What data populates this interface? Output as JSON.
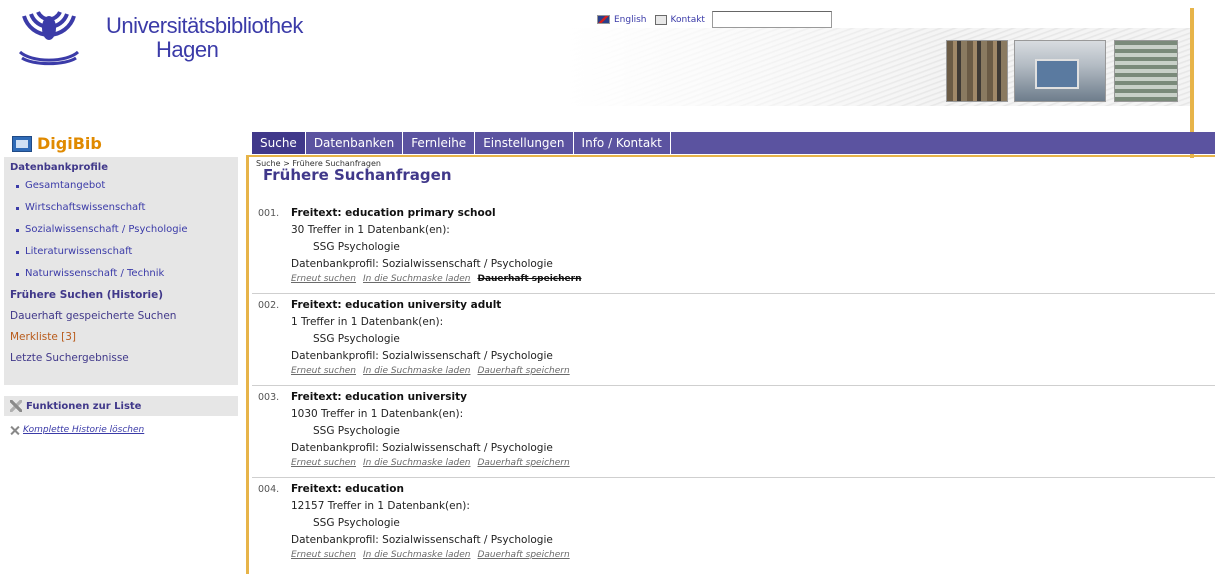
{
  "header": {
    "logo_line1": "Universitätsbibliothek",
    "logo_line2": "Hagen",
    "english_label": "English",
    "contact_label": "Kontakt",
    "search_value": ""
  },
  "brand": {
    "digibib_label": "DigiBib"
  },
  "nav": {
    "tabs": [
      {
        "label": "Suche",
        "active": true
      },
      {
        "label": "Datenbanken"
      },
      {
        "label": "Fernleihe"
      },
      {
        "label": "Einstellungen"
      },
      {
        "label": "Info / Kontakt"
      }
    ],
    "breadcrumb": "Suche > Frühere Suchanfragen"
  },
  "sidebar": {
    "heading": "Datenbankprofile",
    "profiles": [
      "Gesamtangebot",
      "Wirtschaftswissenschaft",
      "Sozialwissenschaft / Psychologie",
      "Literaturwissenschaft",
      "Naturwissenschaft / Technik"
    ],
    "links": [
      "Frühere Suchen (Historie)",
      "Dauerhaft gespeicherte Suchen",
      "Merkliste [3]",
      "Letzte Suchergebnisse"
    ],
    "functions_title": "Funktionen zur Liste",
    "delete_history": "Komplette Historie löschen"
  },
  "main": {
    "title": "Frühere Suchanfragen",
    "results": [
      {
        "num": "001.",
        "title": "Freitext: education primary school",
        "hits": "30 Treffer in 1 Datenbank(en):",
        "db": "SSG Psychologie",
        "profile": "Datenbankprofil: Sozialwissenschaft / Psychologie",
        "action1": "Erneut suchen",
        "action2": "In die Suchmaske laden",
        "action3": "Dauerhaft speichern"
      },
      {
        "num": "002.",
        "title": "Freitext: education university adult",
        "hits": "1 Treffer in 1 Datenbank(en):",
        "db": "SSG Psychologie",
        "profile": "Datenbankprofil: Sozialwissenschaft / Psychologie",
        "action1": "Erneut suchen",
        "action2": "In die Suchmaske laden",
        "action3": "Dauerhaft speichern"
      },
      {
        "num": "003.",
        "title": "Freitext: education university",
        "hits": "1030 Treffer in 1 Datenbank(en):",
        "db": "SSG Psychologie",
        "profile": "Datenbankprofil: Sozialwissenschaft / Psychologie",
        "action1": "Erneut suchen",
        "action2": "In die Suchmaske laden",
        "action3": "Dauerhaft speichern"
      },
      {
        "num": "004.",
        "title": "Freitext: education",
        "hits": "12157 Treffer in 1 Datenbank(en):",
        "db": "SSG Psychologie",
        "profile": "Datenbankprofil: Sozialwissenschaft / Psychologie",
        "action1": "Erneut suchen",
        "action2": "In die Suchmaske laden",
        "action3": "Dauerhaft speichern"
      }
    ]
  },
  "colors": {
    "nav_bg": "#5b53a0",
    "nav_active": "#40388a",
    "accent_gold": "#e7b449",
    "brand_orange": "#e08a00",
    "sidebar_bg": "#e6e6e6"
  }
}
